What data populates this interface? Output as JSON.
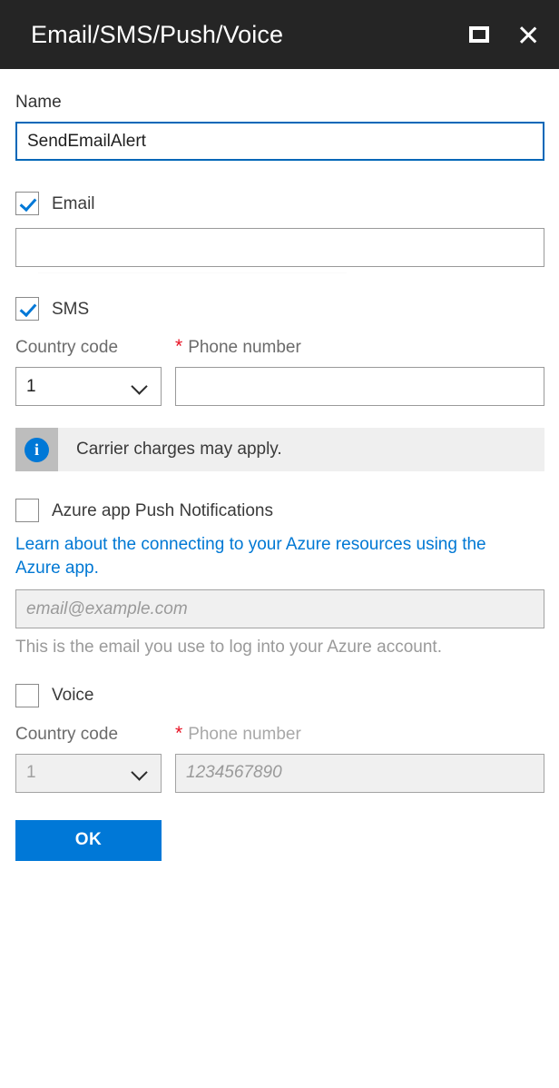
{
  "titlebar": {
    "title": "Email/SMS/Push/Voice",
    "maximize_icon": "maximize-icon",
    "close_icon": "close-icon"
  },
  "form": {
    "name": {
      "label": "Name",
      "value": "SendEmailAlert",
      "placeholder": ""
    },
    "email": {
      "checkbox_label": "Email",
      "checked": "true",
      "value": "",
      "placeholder": ""
    },
    "sms": {
      "checkbox_label": "SMS",
      "checked": "true",
      "country_code_label": "Country code",
      "country_code_value": "1",
      "phone_required_marker": "*",
      "phone_label": "Phone number",
      "phone_value": "",
      "phone_placeholder": "",
      "info_icon": "info-icon",
      "info_text": "Carrier charges may apply."
    },
    "push": {
      "checkbox_label": "Azure app Push Notifications",
      "checked": "false",
      "link_text": "Learn about the connecting to your Azure resources using the Azure app.",
      "email_value": "",
      "email_placeholder": "email@example.com",
      "helper_text": "This is the email you use to log into your Azure account."
    },
    "voice": {
      "checkbox_label": "Voice",
      "checked": "false",
      "country_code_label": "Country code",
      "country_code_value": "1",
      "phone_required_marker": "*",
      "phone_label": "Phone number",
      "phone_value": "",
      "phone_placeholder": "1234567890"
    },
    "ok_label": "OK"
  },
  "colors": {
    "titlebar_bg": "#252525",
    "accent_blue": "#0078d7",
    "focus_blue": "#0067b8",
    "link_blue": "#0078d4",
    "required_red": "#e81123",
    "banner_bg": "#efefef",
    "banner_icon_bg": "#bdbdbd",
    "disabled_bg": "#f0f0f0"
  }
}
